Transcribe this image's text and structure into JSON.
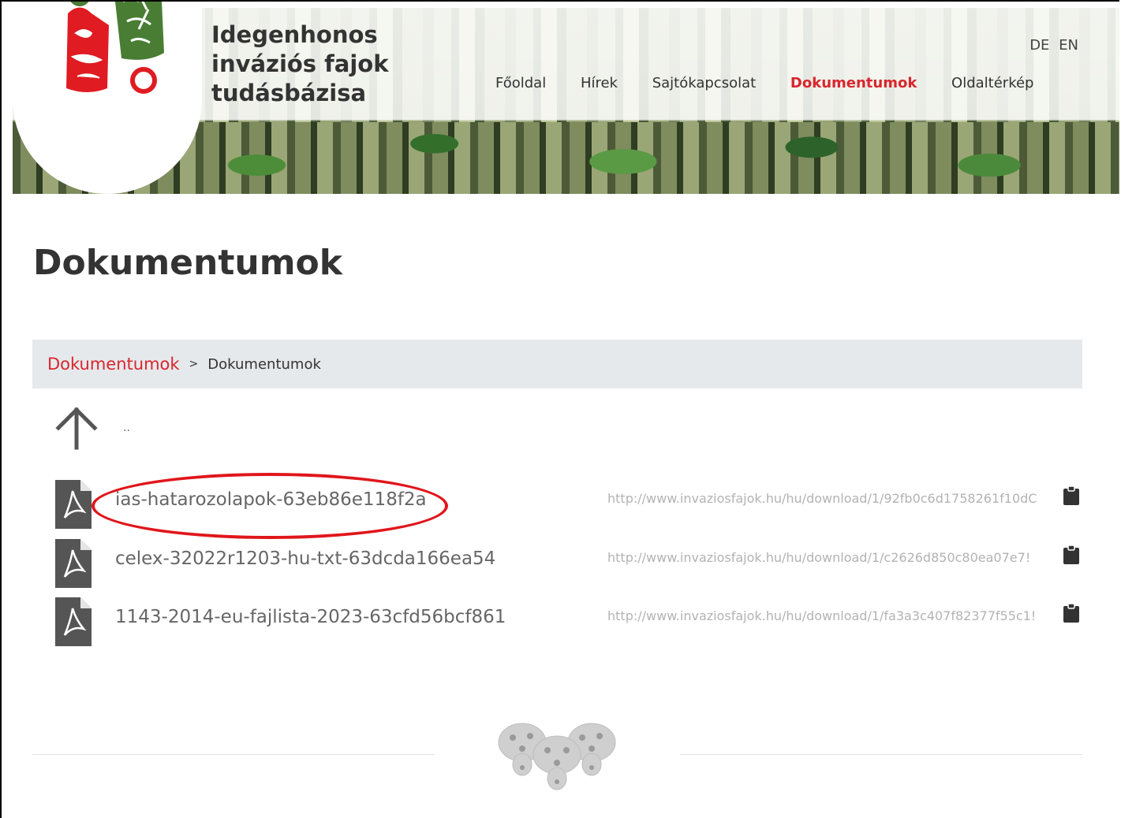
{
  "header": {
    "title_lines": [
      "Idegenhonos",
      "inváziós fajok",
      "tudásbázisa"
    ],
    "languages": [
      "DE",
      "EN"
    ],
    "nav": [
      {
        "label": "Főoldal"
      },
      {
        "label": "Hírek"
      },
      {
        "label": "Sajtókapcsolat"
      },
      {
        "label": "Dokumentumok",
        "active": true
      },
      {
        "label": "Oldaltérkép"
      }
    ]
  },
  "page": {
    "title": "Dokumentumok",
    "breadcrumb": {
      "link": "Dokumentumok",
      "separator": ">",
      "current": "Dokumentumok"
    },
    "parent_dir": ".."
  },
  "files": [
    {
      "name": "ias-hatarozolapok-63eb86e118f2a",
      "url": "http://www.invaziosfajok.hu/hu/download/1/92fb0c6d1758261f10dC",
      "icon": "pdf-icon",
      "highlighted": true
    },
    {
      "name": "celex-32022r1203-hu-txt-63dcda166ea54",
      "url": "http://www.invaziosfajok.hu/hu/download/1/c2626d850c80ea07e7!",
      "icon": "pdf-icon"
    },
    {
      "name": "1143-2014-eu-fajlista-2023-63cfd56bcf861",
      "url": "http://www.invaziosfajok.hu/hu/download/1/fa3a3c407f82377f55c1!",
      "icon": "pdf-icon"
    }
  ],
  "colors": {
    "accent": "#d8262d",
    "logo_green": "#4a7d34",
    "logo_red": "#e01b22",
    "breadcrumb_bg": "#e6e9ec"
  }
}
